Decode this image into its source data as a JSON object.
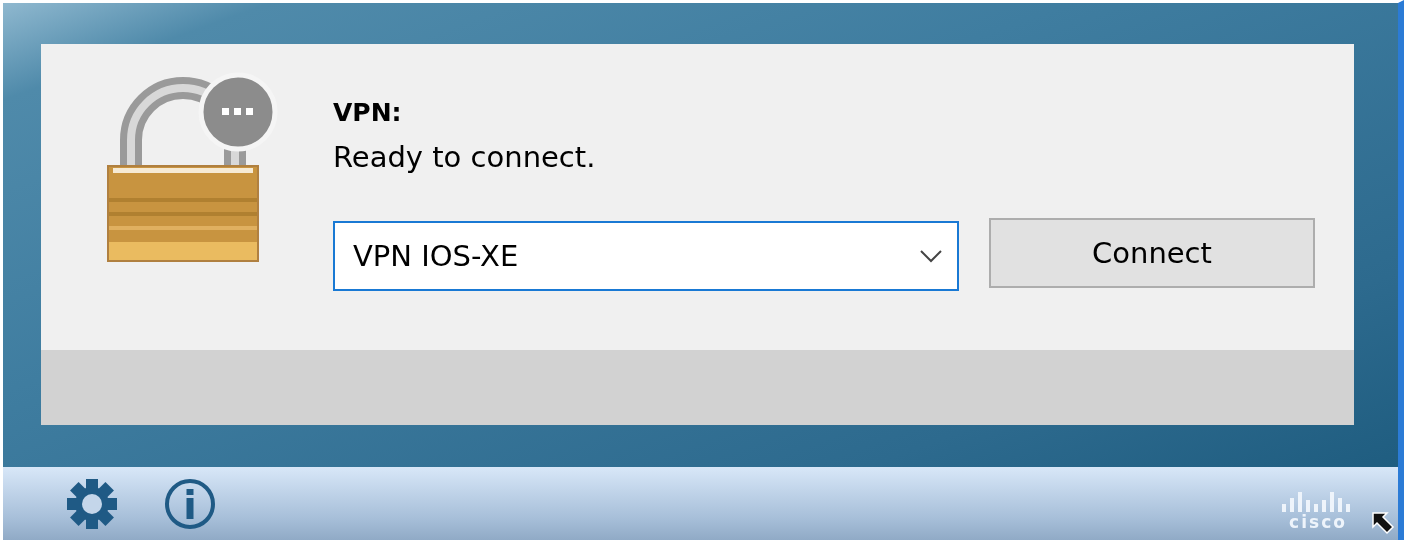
{
  "status": {
    "title": "VPN:",
    "message": "Ready to connect."
  },
  "connection": {
    "value": "VPN IOS-XE"
  },
  "connect_button": {
    "label": "Connect"
  },
  "footer": {
    "logo": "cisco"
  }
}
